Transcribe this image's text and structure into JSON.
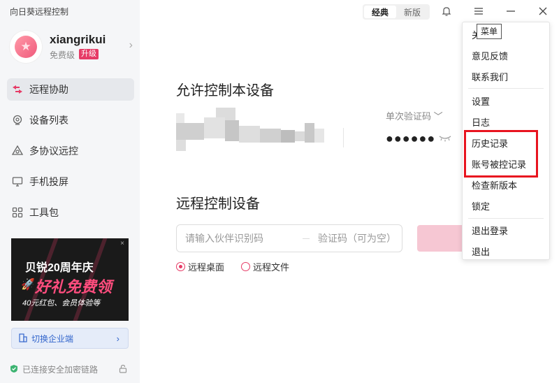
{
  "app": {
    "title": "向日葵远程控制"
  },
  "profile": {
    "username": "xiangrikui",
    "tier": "免费级",
    "upgrade_label": "升级"
  },
  "nav": {
    "items": [
      {
        "label": "远程协助",
        "icon": "remote-assist-icon",
        "active": true
      },
      {
        "label": "设备列表",
        "icon": "device-list-icon",
        "active": false
      },
      {
        "label": "多协议远控",
        "icon": "multi-protocol-icon",
        "active": false
      },
      {
        "label": "手机投屏",
        "icon": "screen-cast-icon",
        "active": false
      },
      {
        "label": "工具包",
        "icon": "toolkit-icon",
        "active": false
      }
    ]
  },
  "promo": {
    "title": "贝锐20周年庆",
    "main": "好礼免费领",
    "sub": "40元红包、会员体验等",
    "close": "×"
  },
  "enterprise": {
    "label": "切换企业端"
  },
  "security": {
    "label": "已连接安全加密链路"
  },
  "mode_toggle": {
    "classic": "经典",
    "new": "新版",
    "selected": "经典"
  },
  "allow_control": {
    "title": "允许控制本设备",
    "code_type": "单次验证码 ﹀",
    "password_mask": "●●●●●●"
  },
  "remote_control": {
    "title": "远程控制设备",
    "partner_placeholder": "请输入伙伴识别码",
    "verify_placeholder": "验证码（可为空）",
    "options": [
      {
        "label": "远程桌面",
        "checked": true
      },
      {
        "label": "远程文件",
        "checked": false
      }
    ]
  },
  "menu": {
    "tooltip": "菜单",
    "first_item_partial": "关",
    "items": [
      {
        "label": "意见反馈"
      },
      {
        "label": "联系我们"
      },
      {
        "label": "设置"
      },
      {
        "label": "日志"
      },
      {
        "label": "历史记录"
      },
      {
        "label": "账号被控记录"
      },
      {
        "label": "检查新版本"
      },
      {
        "label": "锁定"
      },
      {
        "label": "退出登录"
      },
      {
        "label": "退出"
      }
    ]
  },
  "colors": {
    "accent": "#e63b66",
    "highlight": "#e8141f",
    "enterprise_blue": "#3366cc"
  }
}
